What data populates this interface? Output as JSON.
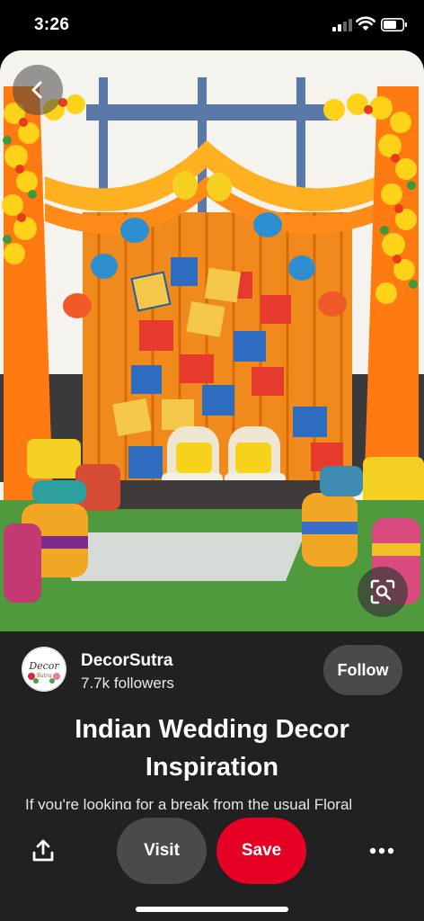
{
  "status_bar": {
    "time": "3:26"
  },
  "pin": {
    "image_alt": "Colorful mehndi stage decor with orange drapes, marigold garlands, hanging kettles and kites",
    "title": "Indian Wedding Decor Inspiration",
    "description": "If you're looking for a break from the usual Floral"
  },
  "creator": {
    "avatar_text": "Decor",
    "avatar_subtext": "Sutra",
    "name": "DecorSutra",
    "followers": "7.7k followers",
    "follow_label": "Follow"
  },
  "actions": {
    "visit_label": "Visit",
    "save_label": "Save"
  },
  "colors": {
    "save": "#e60023",
    "card": "#212121",
    "pill": "#4a4a4a"
  }
}
